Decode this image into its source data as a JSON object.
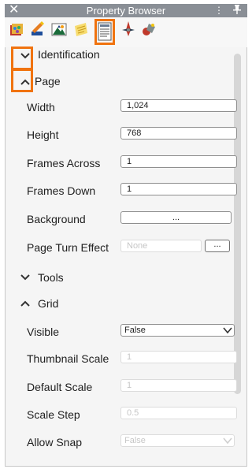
{
  "window": {
    "title": "Property Browser",
    "close_glyph": "✕",
    "menu_glyph": "⋮",
    "pin_glyph": "📌"
  },
  "toolbar": {
    "icons": [
      "book-palette-icon",
      "pencil-brush-icon",
      "image-picture-icon",
      "notes-page-icon",
      "document-page-icon",
      "compass-icon",
      "objects-icon"
    ],
    "highlight_color": "#f0730f"
  },
  "sections": {
    "identification": {
      "title": "Identification",
      "state": "collapsed"
    },
    "page": {
      "title": "Page",
      "state": "expanded"
    },
    "tools": {
      "title": "Tools",
      "state": "collapsed"
    },
    "grid": {
      "title": "Grid",
      "state": "expanded"
    }
  },
  "page": {
    "width": {
      "label": "Width",
      "value": "1,024"
    },
    "height": {
      "label": "Height",
      "value": "768"
    },
    "frames_across": {
      "label": "Frames Across",
      "value": "1"
    },
    "frames_down": {
      "label": "Frames Down",
      "value": "1"
    },
    "background": {
      "label": "Background",
      "value": "..."
    },
    "page_turn_effect": {
      "label": "Page Turn Effect",
      "value": "None",
      "button": "..."
    }
  },
  "grid": {
    "visible": {
      "label": "Visible",
      "value": "False"
    },
    "thumbnail_scale": {
      "label": "Thumbnail Scale",
      "value": "1"
    },
    "default_scale": {
      "label": "Default Scale",
      "value": "1"
    },
    "scale_step": {
      "label": "Scale Step",
      "value": "0.5"
    },
    "allow_snap": {
      "label": "Allow Snap",
      "value": "False"
    }
  }
}
